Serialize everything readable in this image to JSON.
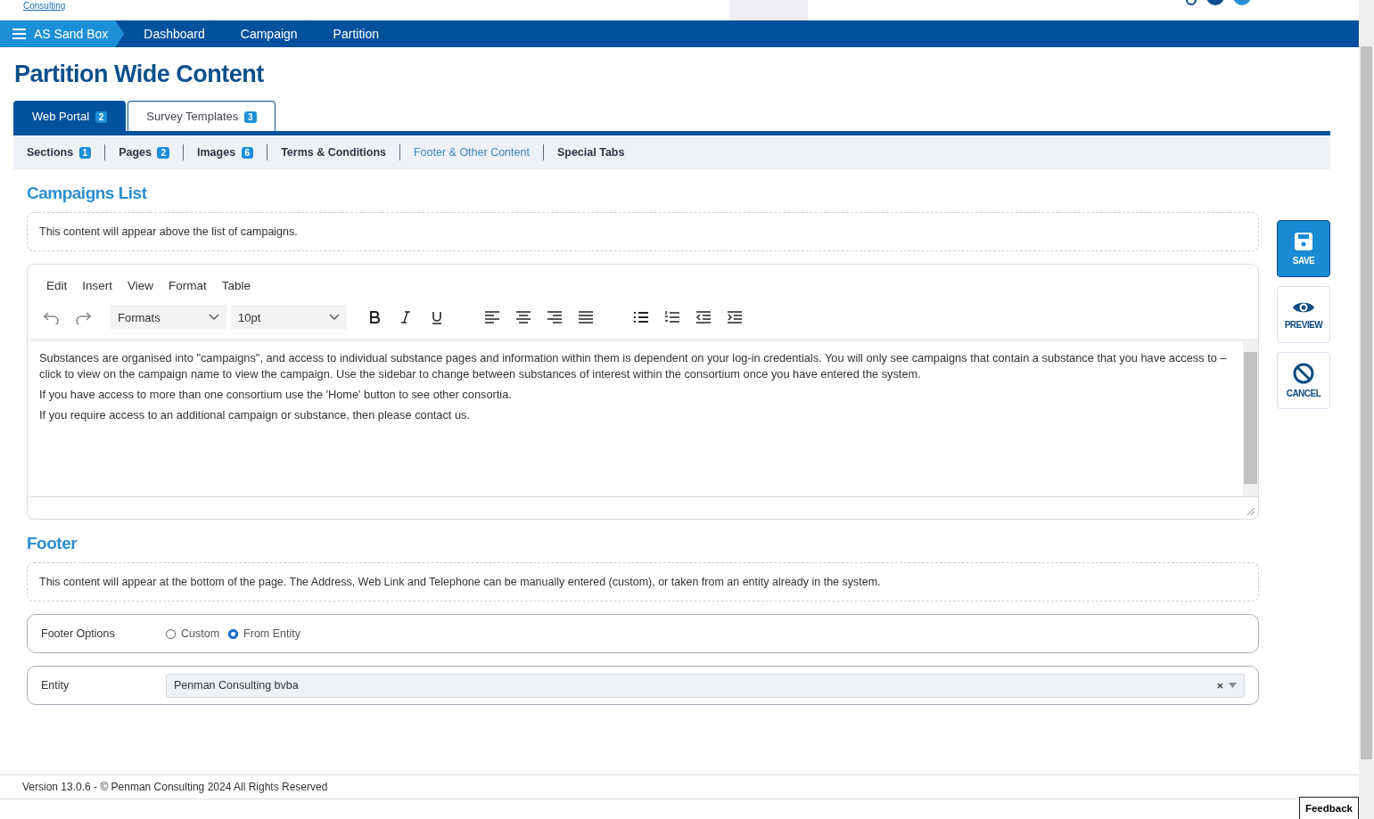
{
  "header": {
    "logo_link": "Consulting"
  },
  "breadcrumb": [
    {
      "label": "AS Sand Box",
      "kind": "home"
    },
    {
      "label": "Dashboard",
      "kind": "crumb"
    },
    {
      "label": "Campaign",
      "kind": "crumb"
    },
    {
      "label": "Partition",
      "kind": "crumb"
    }
  ],
  "page_title": "Partition Wide Content",
  "tabs": [
    {
      "label": "Web Portal",
      "count": "2",
      "selected": true
    },
    {
      "label": "Survey Templates",
      "count": "3",
      "selected": false
    }
  ],
  "subtabs": [
    {
      "label": "Sections",
      "count": "1",
      "selected": false
    },
    {
      "label": "Pages",
      "count": "2",
      "selected": false
    },
    {
      "label": "Images",
      "count": "6",
      "selected": false
    },
    {
      "label": "Terms & Conditions",
      "selected": false
    },
    {
      "label": "Footer & Other Content",
      "selected": true
    },
    {
      "label": "Special Tabs",
      "selected": false
    }
  ],
  "campaigns_list": {
    "heading": "Campaigns List",
    "hint": "This content will appear above the list of campaigns.",
    "editor": {
      "menu": [
        "Edit",
        "Insert",
        "View",
        "Format",
        "Table"
      ],
      "format_select": "Formats",
      "size_select": "10pt",
      "paragraphs": [
        "Substances are organised into \"campaigns\", and access to individual substance pages and information within them is dependent on your log-in credentials. You will only see campaigns that contain a substance that you have access to – click to view on the campaign name to view the campaign. Use the sidebar to change between substances of interest within the consortium once you have entered the system.",
        "If you have access to more than one consortium use the 'Home' button to see other consortia.",
        "If you require access to an additional campaign or substance, then please contact us."
      ]
    }
  },
  "footer": {
    "heading": "Footer",
    "hint": "This content will appear at the bottom of the page. The Address, Web Link and Telephone can be manually entered (custom), or taken from an entity already in the system.",
    "options_label": "Footer Options",
    "options": [
      {
        "label": "Custom",
        "selected": false
      },
      {
        "label": "From Entity",
        "selected": true
      }
    ],
    "entity_label": "Entity",
    "entity_value": "Penman Consulting bvba"
  },
  "actions": [
    {
      "label": "SAVE",
      "kind": "save"
    },
    {
      "label": "PREVIEW",
      "kind": "preview"
    },
    {
      "label": "CANCEL",
      "kind": "cancel"
    }
  ],
  "version": "Version 13.0.6 - © Penman Consulting 2024 All Rights Reserved",
  "feedback": "Feedback"
}
